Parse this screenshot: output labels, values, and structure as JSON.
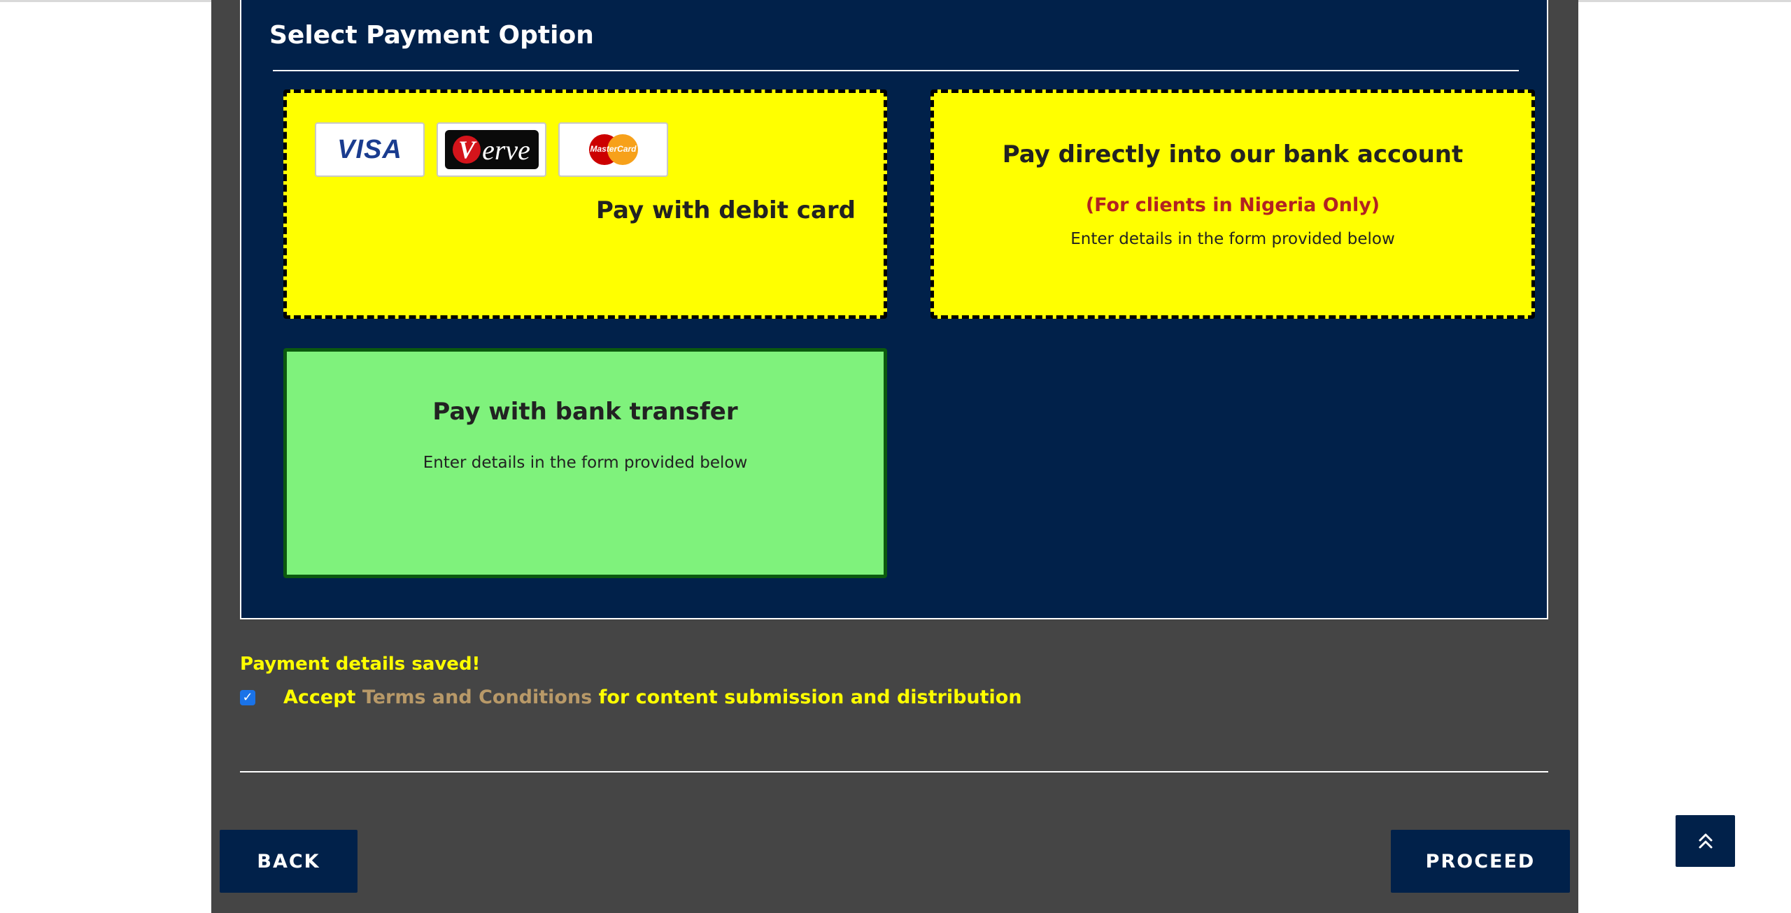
{
  "payment": {
    "title": "Select Payment Option",
    "options": {
      "debit_card": {
        "label": "Pay with debit card",
        "logos": [
          "VISA",
          "erve",
          "MasterCard"
        ]
      },
      "direct_bank": {
        "title": "Pay directly into our bank account",
        "note": "(For clients in Nigeria Only)",
        "subtitle": "Enter details in the form provided below"
      },
      "bank_transfer": {
        "title": "Pay with bank transfer",
        "subtitle": "Enter details in the form provided below"
      }
    }
  },
  "status": {
    "saved_message": "Payment details saved!"
  },
  "terms": {
    "checked": true,
    "prefix": "Accept ",
    "link": "Terms and Conditions",
    "suffix": " for content submission and distribution"
  },
  "buttons": {
    "back": "BACK",
    "proceed": "PROCEED"
  },
  "icons": {
    "scroll_top": "double-chevron-up-icon",
    "checkbox": "check-icon"
  },
  "colors": {
    "navy": "#01214a",
    "panel": "#454545",
    "option_yellow": "#ffff00",
    "option_selected_green": "#7ff27c",
    "status_yellow": "#ffff00",
    "note_red": "#b22222",
    "link_tan": "#b89968",
    "checkbox_blue": "#1a73e8"
  }
}
